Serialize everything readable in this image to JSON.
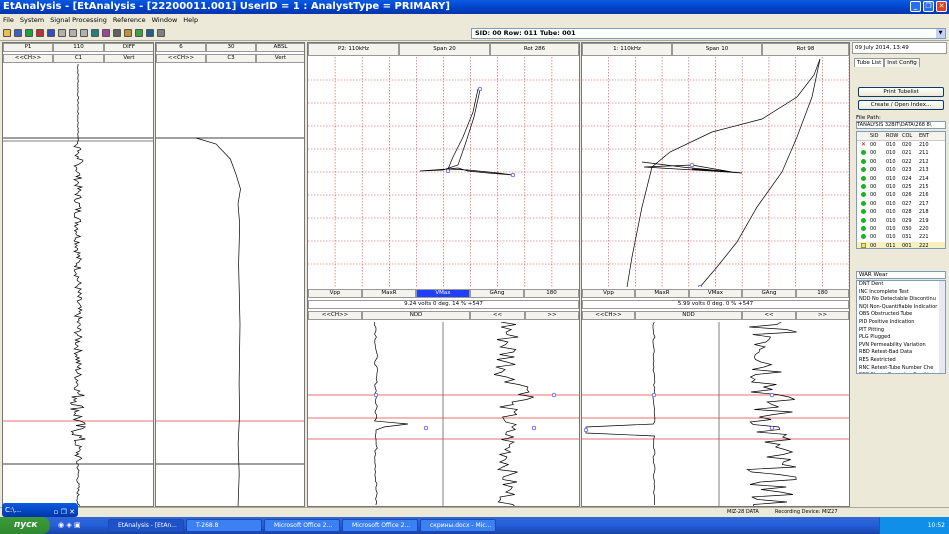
{
  "window": {
    "title": "EtAnalysis - [EtAnalysis - [22200011.001]      UserID = 1 : AnalystType = PRIMARY]"
  },
  "menu": [
    "File",
    "System",
    "Signal Processing",
    "Reference",
    "Window",
    "Help"
  ],
  "toolbar_icons": [
    "open-icon",
    "save-icon",
    "k-icon",
    "r-icon",
    "b-icon",
    "grey-icon",
    "grey-icon",
    "grey-icon",
    "x-icon",
    "p-icon",
    "print-icon",
    "plugin-icon",
    "grid-icon",
    "zoom-icon",
    "tool-icon"
  ],
  "sid_box": "SID: 00   Row: 011   Tube: 001",
  "strip1": {
    "h1": [
      "P1",
      "110",
      "DIFF"
    ],
    "h2": [
      "<<CH>>",
      "C1",
      "Vert"
    ]
  },
  "strip2": {
    "h1": [
      "6",
      "30",
      "ABSL"
    ],
    "h2": [
      "<<CH>>",
      "C3",
      "Vert"
    ]
  },
  "lis1": {
    "header": [
      "P2: 110kHz",
      "Span 20",
      "Rot 286"
    ],
    "footer": [
      "Vpp",
      "MaxR",
      "VMax",
      "GAng",
      "180"
    ],
    "info": "9.24 volts   0 deg. 14 % +547",
    "nav": [
      "<<CH>>",
      "NDD",
      "<<",
      ">>"
    ]
  },
  "lis2": {
    "header": [
      "1: 110kHz",
      "Span 10",
      "Rot 98"
    ],
    "footer": [
      "Vpp",
      "MaxR",
      "VMax",
      "GAng",
      "180"
    ],
    "info": "5.99 volts   0 deg.  0 % +547",
    "nav": [
      "<<CH>>",
      "NDD",
      "<<",
      ">>"
    ]
  },
  "right": {
    "date": "09 July 2014, 13:49",
    "tabs": [
      "Tube List",
      "Inst Config"
    ],
    "print_btn": "Print Tubelist",
    "create_btn": "Create / Open Index...",
    "filepath_label": "File Path:",
    "filepath": "TANALYSIS 32BIT\\DATA\\268 8\\",
    "cols": [
      "SID",
      "ROW",
      "COL",
      "ENT"
    ],
    "rows": [
      {
        "s": "x",
        "sid": "00",
        "row": "010",
        "col": "020",
        "ent": "210"
      },
      {
        "s": "g",
        "sid": "00",
        "row": "010",
        "col": "021",
        "ent": "211"
      },
      {
        "s": "g",
        "sid": "00",
        "row": "010",
        "col": "022",
        "ent": "212"
      },
      {
        "s": "g",
        "sid": "00",
        "row": "010",
        "col": "023",
        "ent": "213"
      },
      {
        "s": "g",
        "sid": "00",
        "row": "010",
        "col": "024",
        "ent": "214"
      },
      {
        "s": "g",
        "sid": "00",
        "row": "010",
        "col": "025",
        "ent": "215"
      },
      {
        "s": "g",
        "sid": "00",
        "row": "010",
        "col": "026",
        "ent": "216"
      },
      {
        "s": "g",
        "sid": "00",
        "row": "010",
        "col": "027",
        "ent": "217"
      },
      {
        "s": "g",
        "sid": "00",
        "row": "010",
        "col": "028",
        "ent": "218"
      },
      {
        "s": "g",
        "sid": "00",
        "row": "010",
        "col": "029",
        "ent": "219"
      },
      {
        "s": "g",
        "sid": "00",
        "row": "010",
        "col": "030",
        "ent": "220"
      },
      {
        "s": "g",
        "sid": "00",
        "row": "010",
        "col": "031",
        "ent": "221"
      },
      {
        "s": "sq",
        "sid": "00",
        "row": "011",
        "col": "001",
        "ent": "222"
      },
      {
        "s": "g",
        "sid": "00",
        "row": "011",
        "col": "002",
        "ent": "223"
      }
    ],
    "code_input": "WAR  Wear",
    "codes": [
      "DNT  Dent",
      "INC  Incomplete Test",
      "NDD  No Detectable Discontinu",
      "NQI  Non-Quantifiable Indicatior",
      "OBS  Obstructed Tube",
      "PID  Positive Indication",
      "PIT  Pitting",
      "PLG  Plugged",
      "PVN  Permeability Variation",
      "RBD  Retest-Bad Data",
      "RES  Restricted",
      "RNC  Retest-Tube Number Che",
      "SCC  Stress Corrosion Crackin",
      "WAR  Wear"
    ]
  },
  "status": [
    "MIZ-28 DATA",
    "Recording Device: MIZ27"
  ],
  "float_window": "C:\\...",
  "taskbar": {
    "start": "пуск",
    "items": [
      "EtAnalysis - [EtAn...",
      "T-268.8",
      "Microsoft Office 2...",
      "Microsoft Office 2...",
      "скрины.docx - Mic..."
    ],
    "lang": "RU",
    "clock": "10:52"
  },
  "colors": {
    "grid": "#e04040",
    "selected": "#2040ff",
    "title": "#0a5be0"
  }
}
